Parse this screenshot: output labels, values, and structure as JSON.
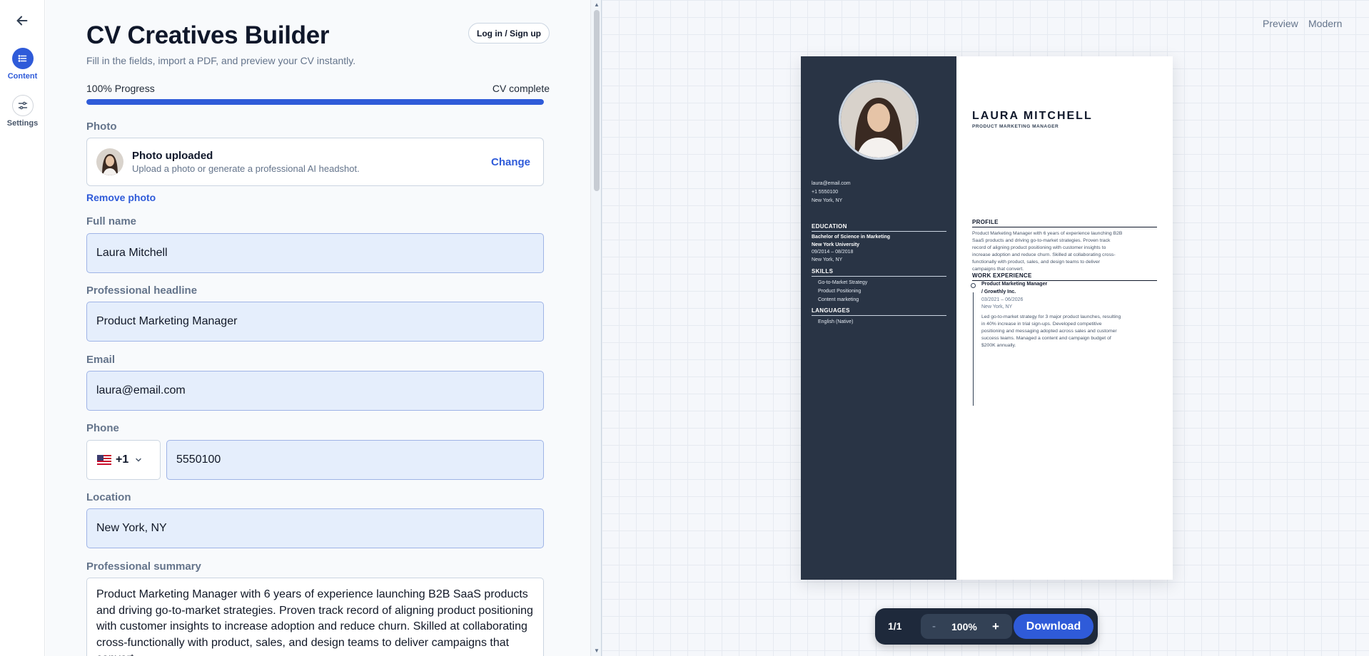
{
  "nav": {
    "items": [
      {
        "label": "Content",
        "icon": "list-icon",
        "active": true
      },
      {
        "label": "Settings",
        "icon": "sliders-icon",
        "active": false
      }
    ]
  },
  "header": {
    "title": "CV Creatives Builder",
    "subtitle": "Fill in the fields, import a PDF, and preview your CV instantly.",
    "login_label": "Log in / Sign up"
  },
  "progress": {
    "label": "100% Progress",
    "status": "CV complete",
    "value": 1.0
  },
  "photo": {
    "label": "Photo",
    "title": "Photo uploaded",
    "subtitle": "Upload a photo or generate a professional AI headshot.",
    "change_label": "Change",
    "remove_label": "Remove photo"
  },
  "fields": {
    "full_name": {
      "label": "Full name",
      "value": "Laura Mitchell"
    },
    "headline": {
      "label": "Professional headline",
      "value": "Product Marketing Manager"
    },
    "email": {
      "label": "Email",
      "value": "laura@email.com"
    },
    "phone": {
      "label": "Phone",
      "country_code": "+1",
      "value": "5550100"
    },
    "location": {
      "label": "Location",
      "value": "New York, NY"
    },
    "summary": {
      "label": "Professional summary",
      "value": "Product Marketing Manager with 6 years of experience launching B2B SaaS products and driving go-to-market strategies. Proven track record of aligning product positioning with customer insights to increase adoption and reduce churn. Skilled at collaborating cross-functionally with product, sales, and design teams to deliver campaigns that convert."
    }
  },
  "preview": {
    "mode_preview": "Preview",
    "mode_template": "Modern",
    "pages": "1/1",
    "zoom": "100%",
    "zoom_out": "-",
    "zoom_in": "+",
    "download_label": "Download"
  },
  "cv": {
    "name": "LAURA MITCHELL",
    "headline": "PRODUCT MARKETING MANAGER",
    "contact": [
      "laura@email.com",
      "+1 5550100",
      "New York, NY"
    ],
    "education_heading": "EDUCATION",
    "degree": "Bachelor of Science in Marketing",
    "school": "New York University",
    "edu_dates": "09/2014 – 08/2018",
    "edu_location": "New York, NY",
    "skills_heading": "SKILLS",
    "skills": [
      "Go-to-Market Strategy",
      "Product Positioning",
      "Content marketing"
    ],
    "languages_heading": "LANGUAGES",
    "languages": [
      "English (Native)"
    ],
    "profile_heading": "PROFILE",
    "profile_lines": [
      "Product Marketing Manager with 6 years of experience launching B2B",
      "SaaS products and driving go-to-market strategies. Proven track",
      "record of aligning product positioning with customer insights to",
      "increase adoption and reduce churn. Skilled at collaborating cross-",
      "functionally with product, sales, and design teams to deliver",
      "campaigns that convert."
    ],
    "work_heading": "WORK EXPERIENCE",
    "job_title": "Product Marketing Manager",
    "job_company": "/ Growthly Inc.",
    "job_dates": "03/2021 – 06/2026",
    "job_location": "New York, NY",
    "job_lines": [
      "Led go-to-market strategy for 3 major product launches, resulting",
      "in 40% increase in trial sign-ups. Developed competitive",
      "positioning and messaging adopted across sales and customer",
      "success teams. Managed a content and campaign budget of",
      "$200K annually."
    ]
  }
}
